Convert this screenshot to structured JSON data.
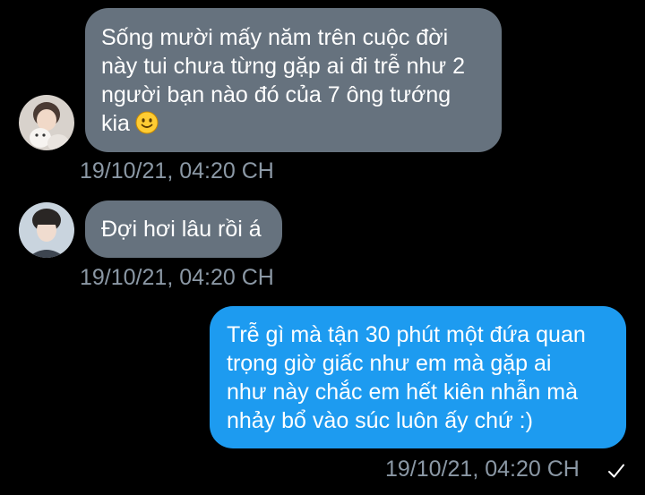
{
  "colors": {
    "background": "#000000",
    "incoming_bubble": "#66727e",
    "outgoing_bubble": "#1d9bf0",
    "timestamp": "#8b98a5"
  },
  "messages": [
    {
      "direction": "incoming",
      "avatar": "avatar-user-1",
      "lines": [
        "Sống mười mấy năm trên cuộc đời",
        "này tui chưa từng gặp ai đi trễ như 2",
        "người bạn nào đó của 7 ông tướng",
        "kia"
      ],
      "emoji": "slightly-smiling-face-icon",
      "timestamp": "19/10/21, 04:20 CH"
    },
    {
      "direction": "incoming",
      "avatar": "avatar-user-2",
      "lines": [
        "Đợi hơi lâu rồi á"
      ],
      "timestamp": "19/10/21, 04:20 CH"
    },
    {
      "direction": "outgoing",
      "lines": [
        "Trễ gì mà tận 30 phút một đứa quan",
        "trọng giờ giấc như em mà gặp ai",
        "như này chắc em hết kiên nhẫn mà",
        "nhảy bổ vào súc luôn ấy chứ :)"
      ],
      "timestamp": "19/10/21, 04:20 CH",
      "status_icon": "sent-check-icon"
    }
  ]
}
